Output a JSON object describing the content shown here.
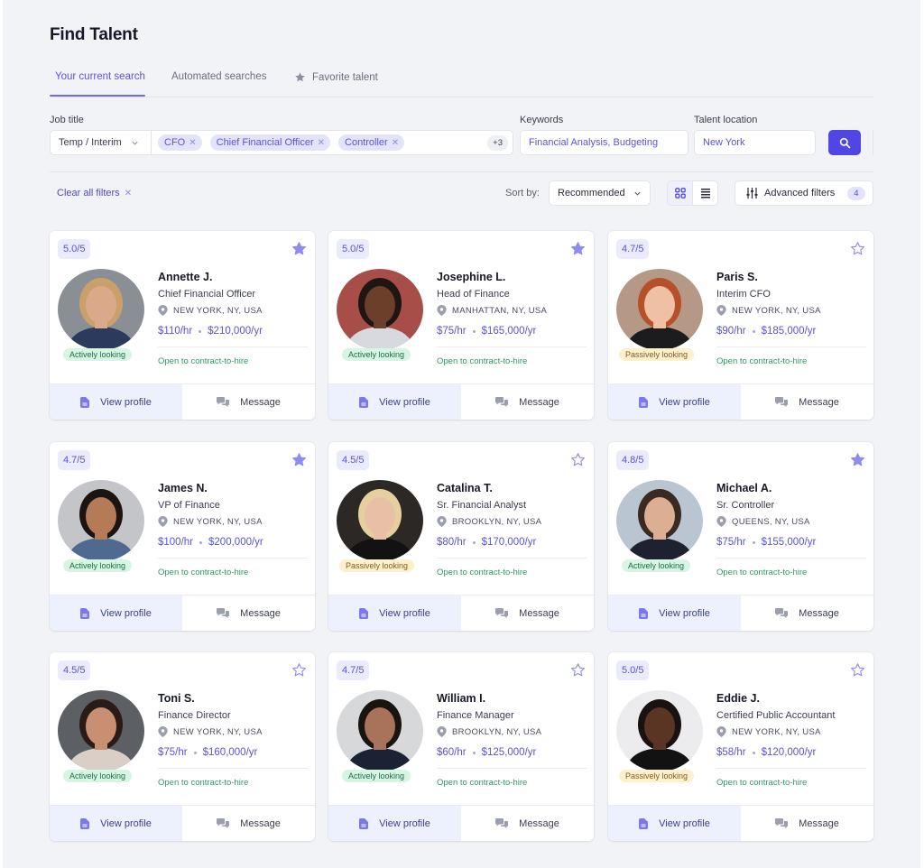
{
  "header": {
    "title": "Find Talent"
  },
  "tabs": [
    {
      "label": "Your current search",
      "active": true
    },
    {
      "label": "Automated searches",
      "active": false
    },
    {
      "label": "Favorite talent",
      "active": false,
      "icon": "star-icon"
    }
  ],
  "filters": {
    "job_title_label": "Job title",
    "job_type": "Temp / Interim",
    "chips": [
      "CFO",
      "Chief Financial Officer",
      "Controller"
    ],
    "more_count": "+3",
    "keywords_label": "Keywords",
    "keywords_value": "Financial Analysis, Budgeting",
    "location_label": "Talent location",
    "location_value": "New York",
    "search_icon": "search-icon"
  },
  "toolbar": {
    "clear_label": "Clear all filters",
    "sort_label": "Sort by:",
    "sort_value": "Recommended",
    "view_modes": [
      "grid-view",
      "list-view"
    ],
    "active_view": "grid-view",
    "advanced_label": "Advanced filters",
    "advanced_count": "4"
  },
  "colors": {
    "accent": "#4f46e5",
    "active_status_bg": "#d6f5e3",
    "passive_status_bg": "#fdf0cc",
    "contract_green": "#2f9a63"
  },
  "card_actions": {
    "view": "View profile",
    "message": "Message"
  },
  "talent": [
    {
      "rating": "5.0/5",
      "favorite": true,
      "name": "Annette J.",
      "role": "Chief Financial Officer",
      "location": "NEW YORK, NY, USA",
      "hourly": "$110/hr",
      "yearly": "$210,000/yr",
      "status": "Actively looking",
      "status_type": "active",
      "contract": "Open to contract-to-hire",
      "avatar": {
        "bg": "#8a8e95",
        "skin": "#d9a98a",
        "hair": "#c9a06a",
        "shirt": "#2c3a5e"
      }
    },
    {
      "rating": "5.0/5",
      "favorite": true,
      "name": "Josephine L.",
      "role": "Head of Finance",
      "location": "MANHATTAN, NY, USA",
      "hourly": "$75/hr",
      "yearly": "$165,000/yr",
      "status": "Actively looking",
      "status_type": "active",
      "contract": "Open to contract-to-hire",
      "avatar": {
        "bg": "#a84e48",
        "skin": "#6b3f2a",
        "hair": "#1f1512",
        "shirt": "#d7d9de"
      }
    },
    {
      "rating": "4.7/5",
      "favorite": false,
      "name": "Paris S.",
      "role": "Interim CFO",
      "location": "NEW YORK, NY, USA",
      "hourly": "$90/hr",
      "yearly": "$185,000/yr",
      "status": "Passively looking",
      "status_type": "passive",
      "contract": "Open to contract-to-hire",
      "avatar": {
        "bg": "#b59886",
        "skin": "#efc0a4",
        "hair": "#b5502a",
        "shirt": "#1c1c1e"
      }
    },
    {
      "rating": "4.7/5",
      "favorite": true,
      "name": "James N.",
      "role": "VP of Finance",
      "location": "NEW YORK, NY, USA",
      "hourly": "$100/hr",
      "yearly": "$200,000/yr",
      "status": "Actively looking",
      "status_type": "active",
      "contract": "Open to contract-to-hire",
      "avatar": {
        "bg": "#c4c5c8",
        "skin": "#b57a57",
        "hair": "#1b1512",
        "shirt": "#4f6a91"
      }
    },
    {
      "rating": "4.5/5",
      "favorite": false,
      "name": "Catalina T.",
      "role": "Sr. Financial Analyst",
      "location": "BROOKLYN, NY, USA",
      "hourly": "$80/hr",
      "yearly": "$170,000/yr",
      "status": "Passively looking",
      "status_type": "passive",
      "contract": "Open to contract-to-hire",
      "avatar": {
        "bg": "#2b2826",
        "skin": "#e8c0a6",
        "hair": "#e5cf9f",
        "shirt": "#121212"
      }
    },
    {
      "rating": "4.8/5",
      "favorite": true,
      "name": "Michael A.",
      "role": "Sr. Controller",
      "location": "QUEENS, NY, USA",
      "hourly": "$75/hr",
      "yearly": "$155,000/yr",
      "status": "Actively looking",
      "status_type": "active",
      "contract": "Open to contract-to-hire",
      "avatar": {
        "bg": "#b9c6d2",
        "skin": "#dcae94",
        "hair": "#3a2a22",
        "shirt": "#1e2230"
      }
    },
    {
      "rating": "4.5/5",
      "favorite": false,
      "name": "Toni S.",
      "role": "Finance Director",
      "location": "NEW YORK, NY, USA",
      "hourly": "$75/hr",
      "yearly": "$160,000/yr",
      "status": "Actively looking",
      "status_type": "active",
      "contract": "Open to contract-to-hire",
      "avatar": {
        "bg": "#5c5f63",
        "skin": "#c88f73",
        "hair": "#2a1b16",
        "shirt": "#d9cfc7"
      }
    },
    {
      "rating": "4.7/5",
      "favorite": false,
      "name": "William I.",
      "role": "Finance Manager",
      "location": "BROOKLYN, NY, USA",
      "hourly": "$60/hr",
      "yearly": "$125,000/yr",
      "status": "Actively looking",
      "status_type": "active",
      "contract": "Open to contract-to-hire",
      "avatar": {
        "bg": "#d7d8da",
        "skin": "#a8735a",
        "hair": "#1a1411",
        "shirt": "#1b2233"
      }
    },
    {
      "rating": "5.0/5",
      "favorite": false,
      "name": "Eddie J.",
      "role": "Certified Public Accountant",
      "location": "NEW YORK, NY, USA",
      "hourly": "$58/hr",
      "yearly": "$120,000/yr",
      "status": "Passively looking",
      "status_type": "passive",
      "contract": "Open to contract-to-hire",
      "avatar": {
        "bg": "#ececee",
        "skin": "#5a3524",
        "hair": "#1a1210",
        "shirt": "#121212"
      }
    }
  ]
}
